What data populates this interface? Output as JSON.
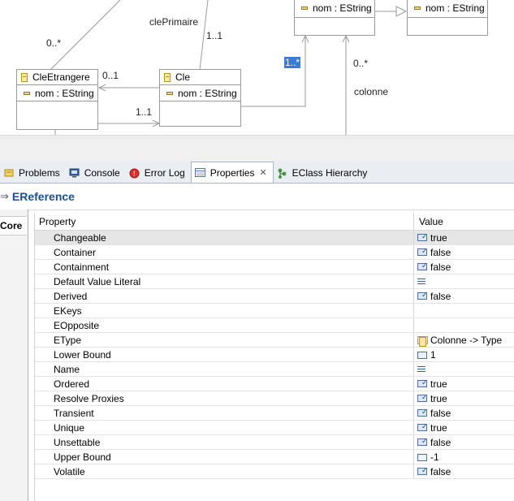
{
  "diagram": {
    "classes": [
      {
        "name": "CleEtrangere",
        "attr": "nom : EString"
      },
      {
        "name": "Cle",
        "attr": "nom : EString"
      },
      {
        "name": "",
        "attr": "nom : EString"
      },
      {
        "name": "",
        "attr": "nom : EString"
      }
    ],
    "labels": {
      "mult_top_left": "0..*",
      "cle_primaire": "clePrimaire",
      "mult_cle_top": "1..1",
      "mult_cle_etr_right": "0..1",
      "mult_cle_etr_bottom": "1..1",
      "mult_selected": "1..*",
      "mult_colonne": "0..*",
      "colonne": "colonne"
    }
  },
  "tabs": [
    {
      "label": "Problems",
      "icon": "problems-icon",
      "active": false
    },
    {
      "label": "Console",
      "icon": "console-icon",
      "active": false
    },
    {
      "label": "Error Log",
      "icon": "error-log-icon",
      "active": false
    },
    {
      "label": "Properties",
      "icon": "properties-icon",
      "active": true
    },
    {
      "label": "EClass Hierarchy",
      "icon": "hierarchy-icon",
      "active": false
    }
  ],
  "properties_view": {
    "title": "EReference",
    "category": "Core",
    "col_property": "Property",
    "col_value": "Value",
    "rows": [
      {
        "property": "Changeable",
        "value": "true",
        "icon": "bool"
      },
      {
        "property": "Container",
        "value": "false",
        "icon": "bool"
      },
      {
        "property": "Containment",
        "value": "false",
        "icon": "bool"
      },
      {
        "property": "Default Value Literal",
        "value": "",
        "icon": "text"
      },
      {
        "property": "Derived",
        "value": "false",
        "icon": "bool"
      },
      {
        "property": "EKeys",
        "value": "",
        "icon": "none"
      },
      {
        "property": "EOpposite",
        "value": "",
        "icon": "none"
      },
      {
        "property": "EType",
        "value": "Colonne -> Type",
        "icon": "cls"
      },
      {
        "property": "Lower Bound",
        "value": "1",
        "icon": "num"
      },
      {
        "property": "Name",
        "value": "",
        "icon": "text"
      },
      {
        "property": "Ordered",
        "value": "true",
        "icon": "bool"
      },
      {
        "property": "Resolve Proxies",
        "value": "true",
        "icon": "bool"
      },
      {
        "property": "Transient",
        "value": "false",
        "icon": "bool"
      },
      {
        "property": "Unique",
        "value": "true",
        "icon": "bool"
      },
      {
        "property": "Unsettable",
        "value": "false",
        "icon": "bool"
      },
      {
        "property": "Upper Bound",
        "value": "-1",
        "icon": "num"
      },
      {
        "property": "Volatile",
        "value": "false",
        "icon": "bool"
      }
    ]
  }
}
